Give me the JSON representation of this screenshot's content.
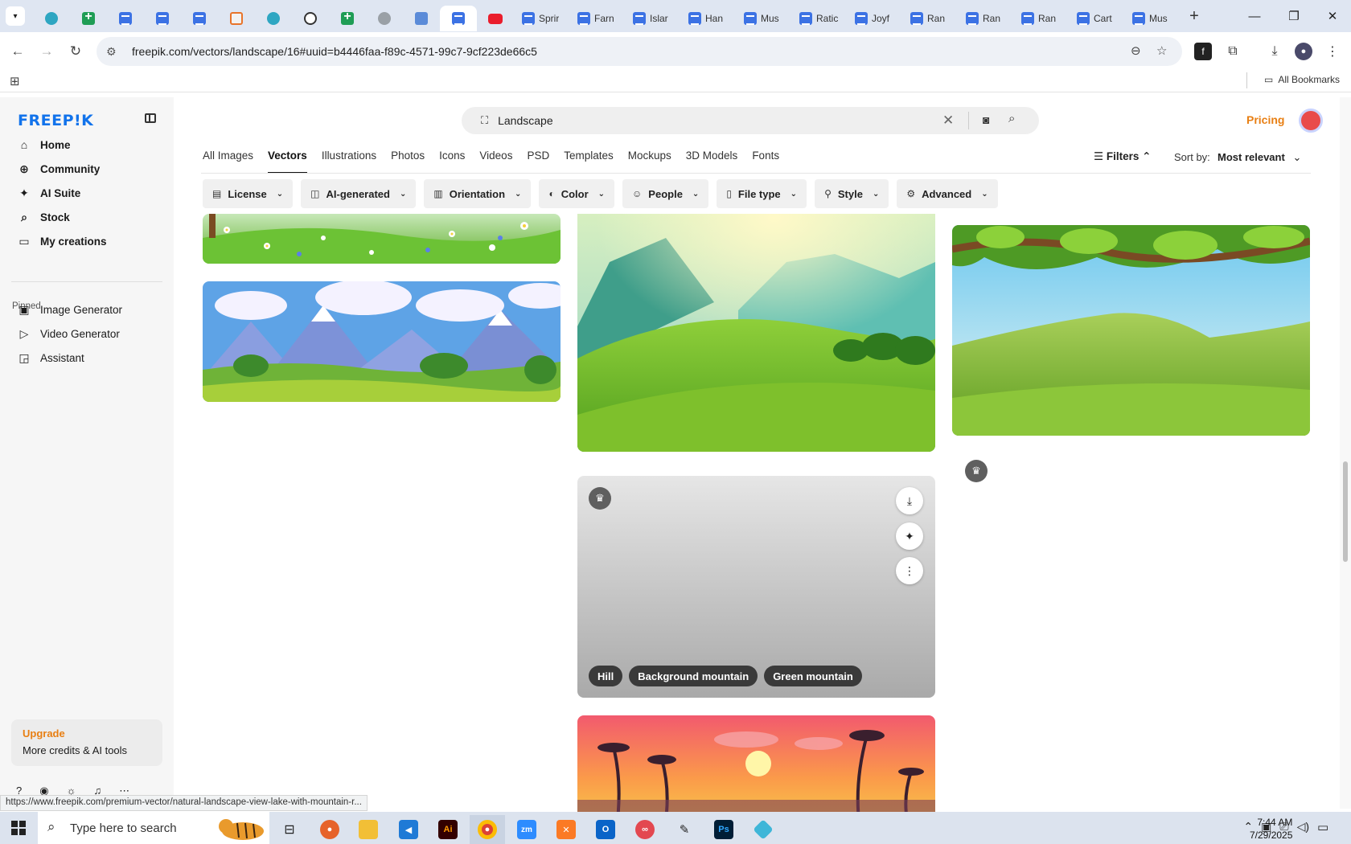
{
  "browser": {
    "tabs": [
      {
        "kind": "pinned",
        "icon": "round"
      },
      {
        "kind": "pinned",
        "icon": "sheet"
      },
      {
        "kind": "pinned",
        "icon": "doc"
      },
      {
        "kind": "pinned",
        "icon": "doc"
      },
      {
        "kind": "pinned",
        "icon": "doc"
      },
      {
        "kind": "pinned",
        "icon": "slide"
      },
      {
        "kind": "pinned",
        "icon": "round"
      },
      {
        "kind": "pinned",
        "icon": "chat"
      },
      {
        "kind": "pinned",
        "icon": "sheet"
      },
      {
        "kind": "pinned",
        "icon": "globe"
      },
      {
        "kind": "pinned",
        "icon": "grid"
      },
      {
        "kind": "pinned",
        "icon": "doc",
        "active": true
      },
      {
        "kind": "pinned",
        "icon": "yt"
      },
      {
        "kind": "titled",
        "icon": "doc",
        "title": "Sprir"
      },
      {
        "kind": "titled",
        "icon": "doc",
        "title": "Farn"
      },
      {
        "kind": "titled",
        "icon": "doc",
        "title": "Islar"
      },
      {
        "kind": "titled",
        "icon": "doc",
        "title": "Han"
      },
      {
        "kind": "titled",
        "icon": "doc",
        "title": "Mus"
      },
      {
        "kind": "titled",
        "icon": "doc",
        "title": "Ratic"
      },
      {
        "kind": "titled",
        "icon": "doc",
        "title": "Joyf"
      },
      {
        "kind": "titled",
        "icon": "doc",
        "title": "Ran"
      },
      {
        "kind": "titled",
        "icon": "doc",
        "title": "Ran"
      },
      {
        "kind": "titled",
        "icon": "doc",
        "title": "Ran"
      },
      {
        "kind": "titled",
        "icon": "doc",
        "title": "Cart"
      },
      {
        "kind": "titled",
        "icon": "doc",
        "title": "Mus"
      }
    ],
    "url": "freepik.com/vectors/landscape/16#uuid=b4446faa-f89c-4571-99c7-9cf223de66c5",
    "bookmarks_label": "All Bookmarks",
    "status_url": "https://www.freepik.com/premium-vector/natural-landscape-view-lake-with-mountain-r..."
  },
  "sidebar": {
    "logo": "FREEP!K",
    "nav": [
      {
        "label": "Home",
        "icon": "home-icon",
        "glyph": "⌂"
      },
      {
        "label": "Community",
        "icon": "globe-icon",
        "glyph": "⊕"
      },
      {
        "label": "AI Suite",
        "icon": "sparkle-icon",
        "glyph": "✦"
      },
      {
        "label": "Stock",
        "icon": "search-icon",
        "glyph": "⌕"
      },
      {
        "label": "My creations",
        "icon": "folder-icon",
        "glyph": "▭"
      }
    ],
    "pinned_label": "Pinned",
    "pinned": [
      {
        "label": "Image Generator",
        "icon": "image-icon",
        "glyph": "▣"
      },
      {
        "label": "Video Generator",
        "icon": "video-icon",
        "glyph": "▷"
      },
      {
        "label": "Assistant",
        "icon": "chat-icon",
        "glyph": "◲"
      }
    ],
    "upgrade_title": "Upgrade",
    "upgrade_sub": "More credits & AI tools"
  },
  "search": {
    "query": "Landscape"
  },
  "header": {
    "pricing": "Pricing",
    "categories": [
      "All Images",
      "Vectors",
      "Illustrations",
      "Photos",
      "Icons",
      "Videos",
      "PSD",
      "Templates",
      "Mockups",
      "3D Models",
      "Fonts"
    ],
    "active_category": "Vectors",
    "filters_label": "Filters",
    "sort_label": "Sort by:",
    "sort_value": "Most relevant"
  },
  "filters": [
    {
      "label": "License",
      "icon": "license-icon",
      "glyph": "▤"
    },
    {
      "label": "AI-generated",
      "icon": "ai-icon",
      "glyph": "◫"
    },
    {
      "label": "Orientation",
      "icon": "orientation-icon",
      "glyph": "▥"
    },
    {
      "label": "Color",
      "icon": "palette-icon",
      "glyph": "◐"
    },
    {
      "label": "People",
      "icon": "people-icon",
      "glyph": "☺"
    },
    {
      "label": "File type",
      "icon": "file-icon",
      "glyph": "▯"
    },
    {
      "label": "Style",
      "icon": "brush-icon",
      "glyph": "⚲"
    },
    {
      "label": "Advanced",
      "icon": "gear-icon",
      "glyph": "⚙"
    }
  ],
  "hover_card": {
    "tags": [
      "Hill",
      "Background mountain",
      "Green mountain"
    ]
  },
  "taskbar": {
    "search_placeholder": "Type here to search",
    "time": "7:44 AM",
    "date": "7/29/2025"
  },
  "colors": {
    "brand": "#1273eb",
    "accent": "#e87f13"
  }
}
